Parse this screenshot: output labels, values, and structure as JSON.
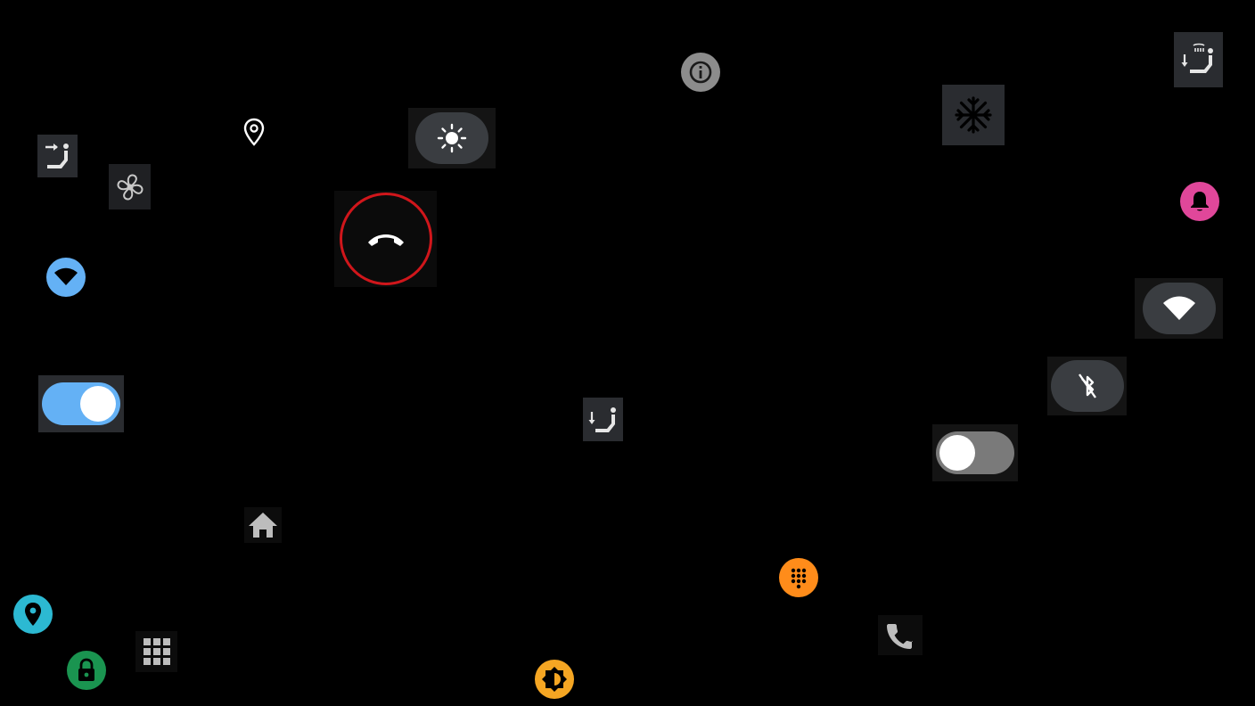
{
  "screen": {
    "background": "#000000",
    "widgets": [
      {
        "id": "seat-forward-icon-button",
        "icon": "seat-forward-icon",
        "style": "tile"
      },
      {
        "id": "fan-icon-button",
        "icon": "fan-icon",
        "style": "tile"
      },
      {
        "id": "location-pin-icon-button",
        "icon": "location-pin-icon",
        "style": "plain"
      },
      {
        "id": "brightness-pill-button",
        "icon": "sun-icon",
        "style": "pill"
      },
      {
        "id": "end-call-button",
        "icon": "phone-hangup-icon",
        "style": "ring",
        "accent": "#d0161b"
      },
      {
        "id": "info-button",
        "icon": "info-icon",
        "style": "grey-circle"
      },
      {
        "id": "ac-snowflake-button",
        "icon": "snowflake-icon",
        "style": "tile"
      },
      {
        "id": "seat-heat-down-button",
        "icon": "seat-heat-down-icon",
        "style": "tile"
      },
      {
        "id": "notification-bell-button",
        "icon": "bell-icon",
        "accent": "#e0479a"
      },
      {
        "id": "wifi-badge-button",
        "icon": "wifi-icon",
        "accent": "#64b1f5"
      },
      {
        "id": "wifi-pill-button",
        "icon": "wifi-icon",
        "style": "pill"
      },
      {
        "id": "bluetooth-off-button",
        "icon": "bluetooth-off-icon",
        "style": "pill"
      },
      {
        "id": "toggle-on-switch",
        "state": "on",
        "accent": "#64b1f5"
      },
      {
        "id": "seat-recline-button",
        "icon": "seat-recline-icon",
        "style": "tile"
      },
      {
        "id": "toggle-off-switch",
        "state": "off"
      },
      {
        "id": "home-button",
        "icon": "home-icon"
      },
      {
        "id": "dialpad-button",
        "icon": "dialpad-icon",
        "accent": "#ff8c1a"
      },
      {
        "id": "navigation-pin-button",
        "icon": "location-pin-icon",
        "accent": "#2cb9d2"
      },
      {
        "id": "lock-button",
        "icon": "lock-icon",
        "accent": "#1a9450"
      },
      {
        "id": "app-grid-button",
        "icon": "apps-grid-icon"
      },
      {
        "id": "auto-brightness-button",
        "icon": "brightness-auto-icon",
        "accent": "#f5a623"
      },
      {
        "id": "phone-button",
        "icon": "phone-icon"
      }
    ]
  },
  "colors": {
    "tile": "#2a2c30",
    "pill": "#3a3d41",
    "icon_light": "#e6e6e6",
    "toggle_on_track": "#64b1f5",
    "toggle_off_track": "#7a7a7a"
  }
}
